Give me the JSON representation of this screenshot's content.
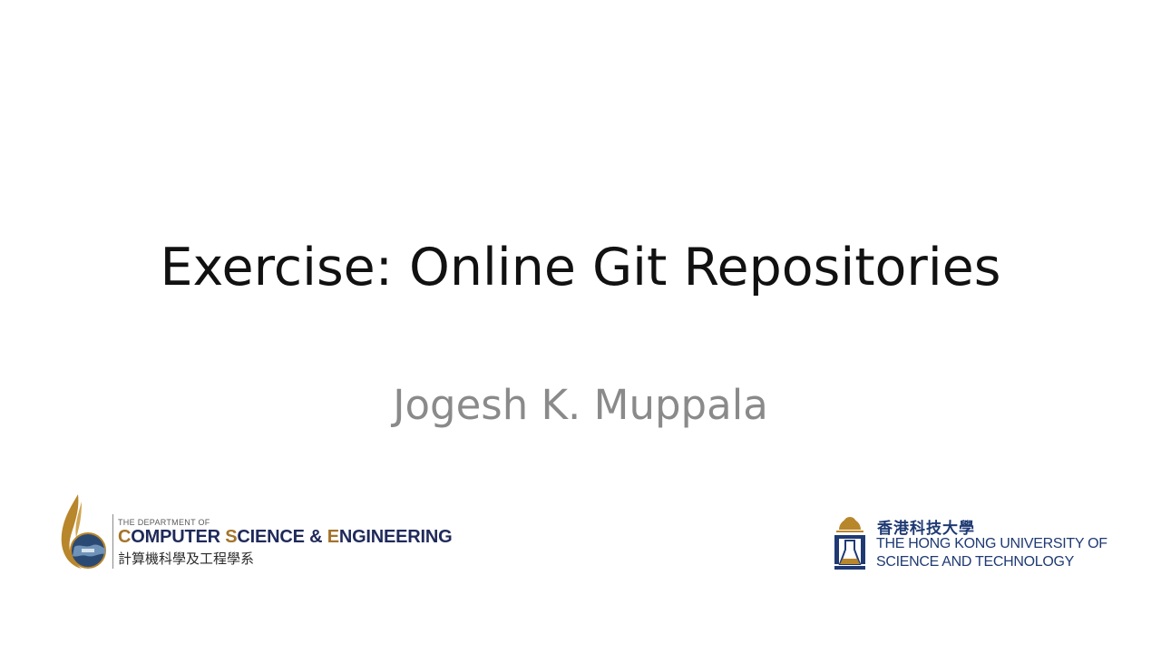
{
  "slide": {
    "title": "Exercise: Online Git Repositories",
    "subtitle": "Jogesh K. Muppala"
  },
  "cse_logo": {
    "dept_prefix": "THE DEPARTMENT OF",
    "name_parts": [
      {
        "cap": "C",
        "rest": "OMPUTER "
      },
      {
        "cap": "S",
        "rest": "CIENCE & "
      },
      {
        "cap": "E",
        "rest": "NGINEERING"
      }
    ],
    "chinese": "計算機科學及工程學系"
  },
  "ust_logo": {
    "chinese": "香港科技大學",
    "english_line1": "THE HONG KONG UNIVERSITY OF",
    "english_line2": "SCIENCE AND TECHNOLOGY"
  },
  "colors": {
    "title": "#111111",
    "subtitle": "#8a8a8a",
    "cse_navy": "#1f2a5a",
    "cse_gold": "#a4742a",
    "ust_navy": "#1f3a73",
    "ust_gold": "#b8862b"
  }
}
